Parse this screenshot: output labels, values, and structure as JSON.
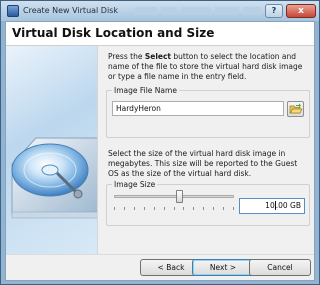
{
  "window": {
    "title": "Create New Virtual Disk",
    "help_button": "?",
    "close_button": "x",
    "icon": "virtualbox-app-icon"
  },
  "header": {
    "title": "Virtual Disk Location and Size"
  },
  "side_image": {
    "icon": "hard-disk-illustration"
  },
  "instructions": {
    "part1": "Press the ",
    "emphasis": "Select",
    "part2": " button to select the location and name of the file to store the virtual hard disk image or type a file name in the entry field."
  },
  "image_file": {
    "group_label": "Image File Name",
    "value": "HardyHeron",
    "browse_icon": "folder-open-icon"
  },
  "size_help": {
    "text": "Select the size of the virtual hard disk image in megabytes. This size will be reported to the Guest OS as the size of the virtual hard disk."
  },
  "image_size": {
    "group_label": "Image Size",
    "value_before_caret": "10",
    "value_after_caret": ".00 GB",
    "slider_fraction": 0.55
  },
  "buttons": {
    "back": "< Back",
    "next": "Next >",
    "cancel": "Cancel"
  },
  "colors": {
    "title_bar": "#a6c4de",
    "close_button": "#c8463a",
    "dialog_background": "#f0f0f0",
    "default_button_border": "#3c7fb1"
  }
}
